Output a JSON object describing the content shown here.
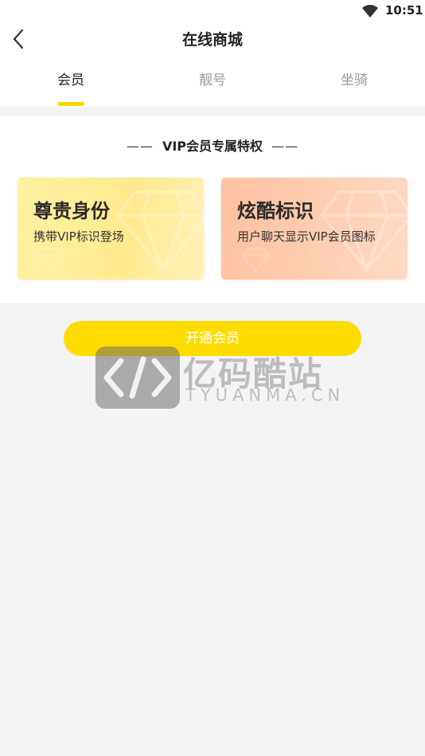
{
  "status_bar": {
    "time": "10:51"
  },
  "nav": {
    "title": "在线商城"
  },
  "tabs": [
    {
      "label": "会员",
      "active": true
    },
    {
      "label": "靓号",
      "active": false
    },
    {
      "label": "坐骑",
      "active": false
    }
  ],
  "benefits": {
    "heading_left": "——",
    "heading": "VIP会员专属特权",
    "heading_right": "——",
    "cards": [
      {
        "title": "尊贵身份",
        "desc": "携带VIP标识登场"
      },
      {
        "title": "炫酷标识",
        "desc": "用户聊天显示VIP会员图标"
      }
    ]
  },
  "cta": {
    "label": "开通会员"
  },
  "watermark": {
    "brand": "亿码酷站",
    "sub": "TYUANMA.CN"
  },
  "colors": {
    "accent": "#ffdc00",
    "background": "#f4f4f4",
    "card_gold": "#ffe98e",
    "card_peach": "#ffcfb2"
  },
  "icons": [
    "wifi-icon",
    "back-arrow-icon",
    "diamond-icon"
  ]
}
